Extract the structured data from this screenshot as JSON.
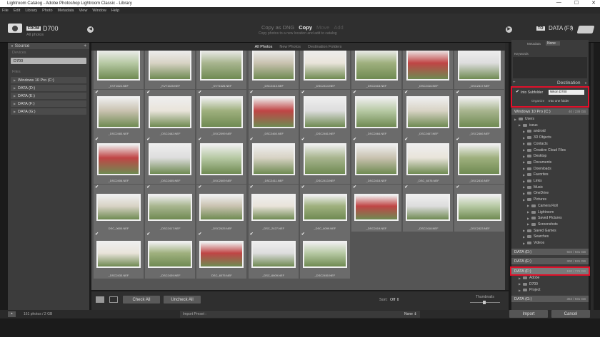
{
  "window": {
    "title": "Lightroom Catalog - Adobe Photoshop Lightroom Classic - Library",
    "min": "—",
    "max": "☐",
    "close": "✕"
  },
  "menu": [
    "File",
    "Edit",
    "Library",
    "Photo",
    "Metadata",
    "View",
    "Window",
    "Help"
  ],
  "header": {
    "from": "FROM",
    "device": "D700",
    "device_sub": "All photos",
    "modes": [
      "Copy as DNG",
      "Copy",
      "Move",
      "Add"
    ],
    "mode_sub": "Copy photos to a new location and add to catalog",
    "to": "TO",
    "dest": "DATA (F:)",
    "dest_arrow": "⇕"
  },
  "source": {
    "title": "Source",
    "add": "+",
    "devices_label": "Devices",
    "device_item": "D700",
    "files_label": "Files",
    "drives": [
      "Windows 10 Pro (C:)",
      "DATA (D:)",
      "DATA (E:)",
      "DATA (F:)",
      "DATA (G:)"
    ]
  },
  "filter_tabs": [
    "All Photos",
    "New Photos",
    "Destination Folders"
  ],
  "rows": [
    {
      "names": [
        "_KVT1624.NEF",
        "_KVT1625.NEF",
        "_KVT1626.NEF",
        "_DSC2413.NEF",
        "_DSC2414.NEF",
        "_DSC2415.NEF",
        "_DSC2416.NEF",
        "_DSC2417.NEF"
      ]
    },
    {
      "names": [
        "_DSC2483.NEF",
        "_DSC2482.NEF",
        "_DSC2099.NEF",
        "_DSC2460.NEF",
        "_DSC2461.NEF",
        "_DSC2464.NEF",
        "_DSC2467.NEF",
        "_DSC2466.NEF"
      ]
    },
    {
      "names": [
        "_DSC2406.NEF",
        "_DSC2405.NEF",
        "_DSC2409.NEF",
        "_DSC2411.NEF",
        "_DSC2413.NEF",
        "_DSC2415.NEF",
        "_DSC_6076.NEF",
        "_DSC2416.NEF"
      ]
    },
    {
      "names": [
        "DSC_0600.NEF",
        "_DSC2417.NEF",
        "_DSC2425.NEF",
        "_DSC_2427.NEF",
        "_DSC_6099.NEF",
        "_DSC2419.NEF",
        "_DSC2418.NEF",
        "_DSC2423.NEF"
      ]
    },
    {
      "names": [
        "_DSC2433.NEF",
        "_DSC2439.NEF",
        "DSC_6075.NEF",
        "_DSC_6609.NEF",
        "_DSC2450.NEF"
      ]
    }
  ],
  "grid_toolbar": {
    "check_all": "Check All",
    "uncheck_all": "Uncheck All",
    "sort_label": "Sort:",
    "sort_value": "Off ⇕",
    "thumbs_label": "Thumbnails"
  },
  "right": {
    "metadata_label": "Metadata",
    "metadata_value": "None",
    "keywords_label": "Keywords",
    "destination_title": "Destination",
    "plus": "+",
    "into_subfolder": "Into Subfolder",
    "subfolder_value": "Nikon D700",
    "organize_label": "Organize",
    "organize_value": "Into one folder",
    "volumes": [
      {
        "name": "Windows 10 Pro (C:)",
        "size": "40 / 238 GB"
      },
      {
        "name": "DATA (D:)",
        "size": "604 / 931 GB"
      },
      {
        "name": "DATA (E:)",
        "size": "300 / 931 GB"
      },
      {
        "name": "DATA (F:)",
        "size": "180 / 775 GB"
      },
      {
        "name": "DATA (G:)",
        "size": "364 / 931 GB"
      }
    ],
    "tree_c": [
      "Users",
      "iseus",
      "android",
      "3D Objects",
      "Contacts",
      "Creative Cloud Files",
      "Desktop",
      "Documents",
      "Downloads",
      "Favorites",
      "Links",
      "Music",
      "OneDrive",
      "Pictures",
      "Camera Roll",
      "Lightroom",
      "Saved Pictures",
      "Screenshots",
      "Saved Games",
      "Searches",
      "Videos"
    ],
    "tree_f": [
      "Adobe",
      "D700",
      "Project"
    ]
  },
  "footer": {
    "count": "161 photos / 2 GB",
    "preset_label": "Import Preset :",
    "preset_value": "None ⇕",
    "import": "Import",
    "cancel": "Cancel"
  }
}
